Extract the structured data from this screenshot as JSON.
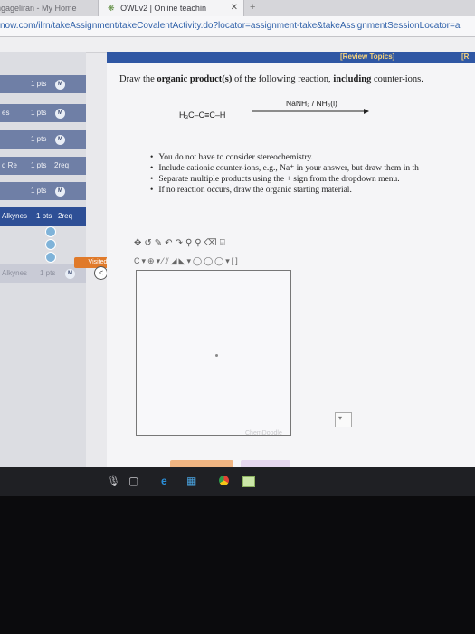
{
  "browser": {
    "tabs": [
      {
        "label": "ngageliran - My Home",
        "active": false
      },
      {
        "label": "OWLv2 | Online teachin",
        "active": true
      }
    ],
    "url": "now.com/ilrn/takeAssignment/takeCovalentActivity.do?locator=assignment-take&takeAssignmentSessionLocator=a"
  },
  "leftnav": {
    "rows": [
      {
        "label": "",
        "pts": "1 pts",
        "req": "",
        "badge": "M"
      },
      {
        "label": "es",
        "pts": "1 pts",
        "req": "",
        "badge": "M"
      },
      {
        "label": "",
        "pts": "1 pts",
        "req": "",
        "badge": "M"
      },
      {
        "label": "d Re",
        "pts": "1 pts",
        "req": "2req",
        "badge": ""
      },
      {
        "label": "",
        "pts": "1 pts",
        "req": "",
        "badge": "M"
      },
      {
        "label": "Alkynes",
        "pts": "1 pts",
        "req": "2req",
        "badge": ""
      },
      {
        "label": "Alkynes",
        "pts": "1 pts",
        "req": "",
        "badge": "M"
      }
    ],
    "visited_label": "Visited",
    "back_icon": "<"
  },
  "main": {
    "review_link": "[Review Topics]",
    "review_right": "[R",
    "question_pre": "Draw the ",
    "question_b1": "organic product(s)",
    "question_mid": " of the following reaction, ",
    "question_b2": "including",
    "question_post": " counter-ions.",
    "reactant": "H₃C–C≡C–H",
    "reagent": "NaNH₂ / NH₃(l)",
    "bullets": [
      "You do not have to consider stereochemistry.",
      "Include cationic counter-ions, e.g., Na⁺ in your answer, but draw them in th",
      "Separate multiple products using the + sign from the dropdown menu.",
      "If no reaction occurs, draw the organic starting material."
    ],
    "watermark": "ChemDoodle"
  },
  "colors": {
    "nav_blue": "#6f7fa6",
    "nav_active": "#2e4f96",
    "review_bar": "#2f57a4",
    "visited_orange": "#e07a2a"
  }
}
